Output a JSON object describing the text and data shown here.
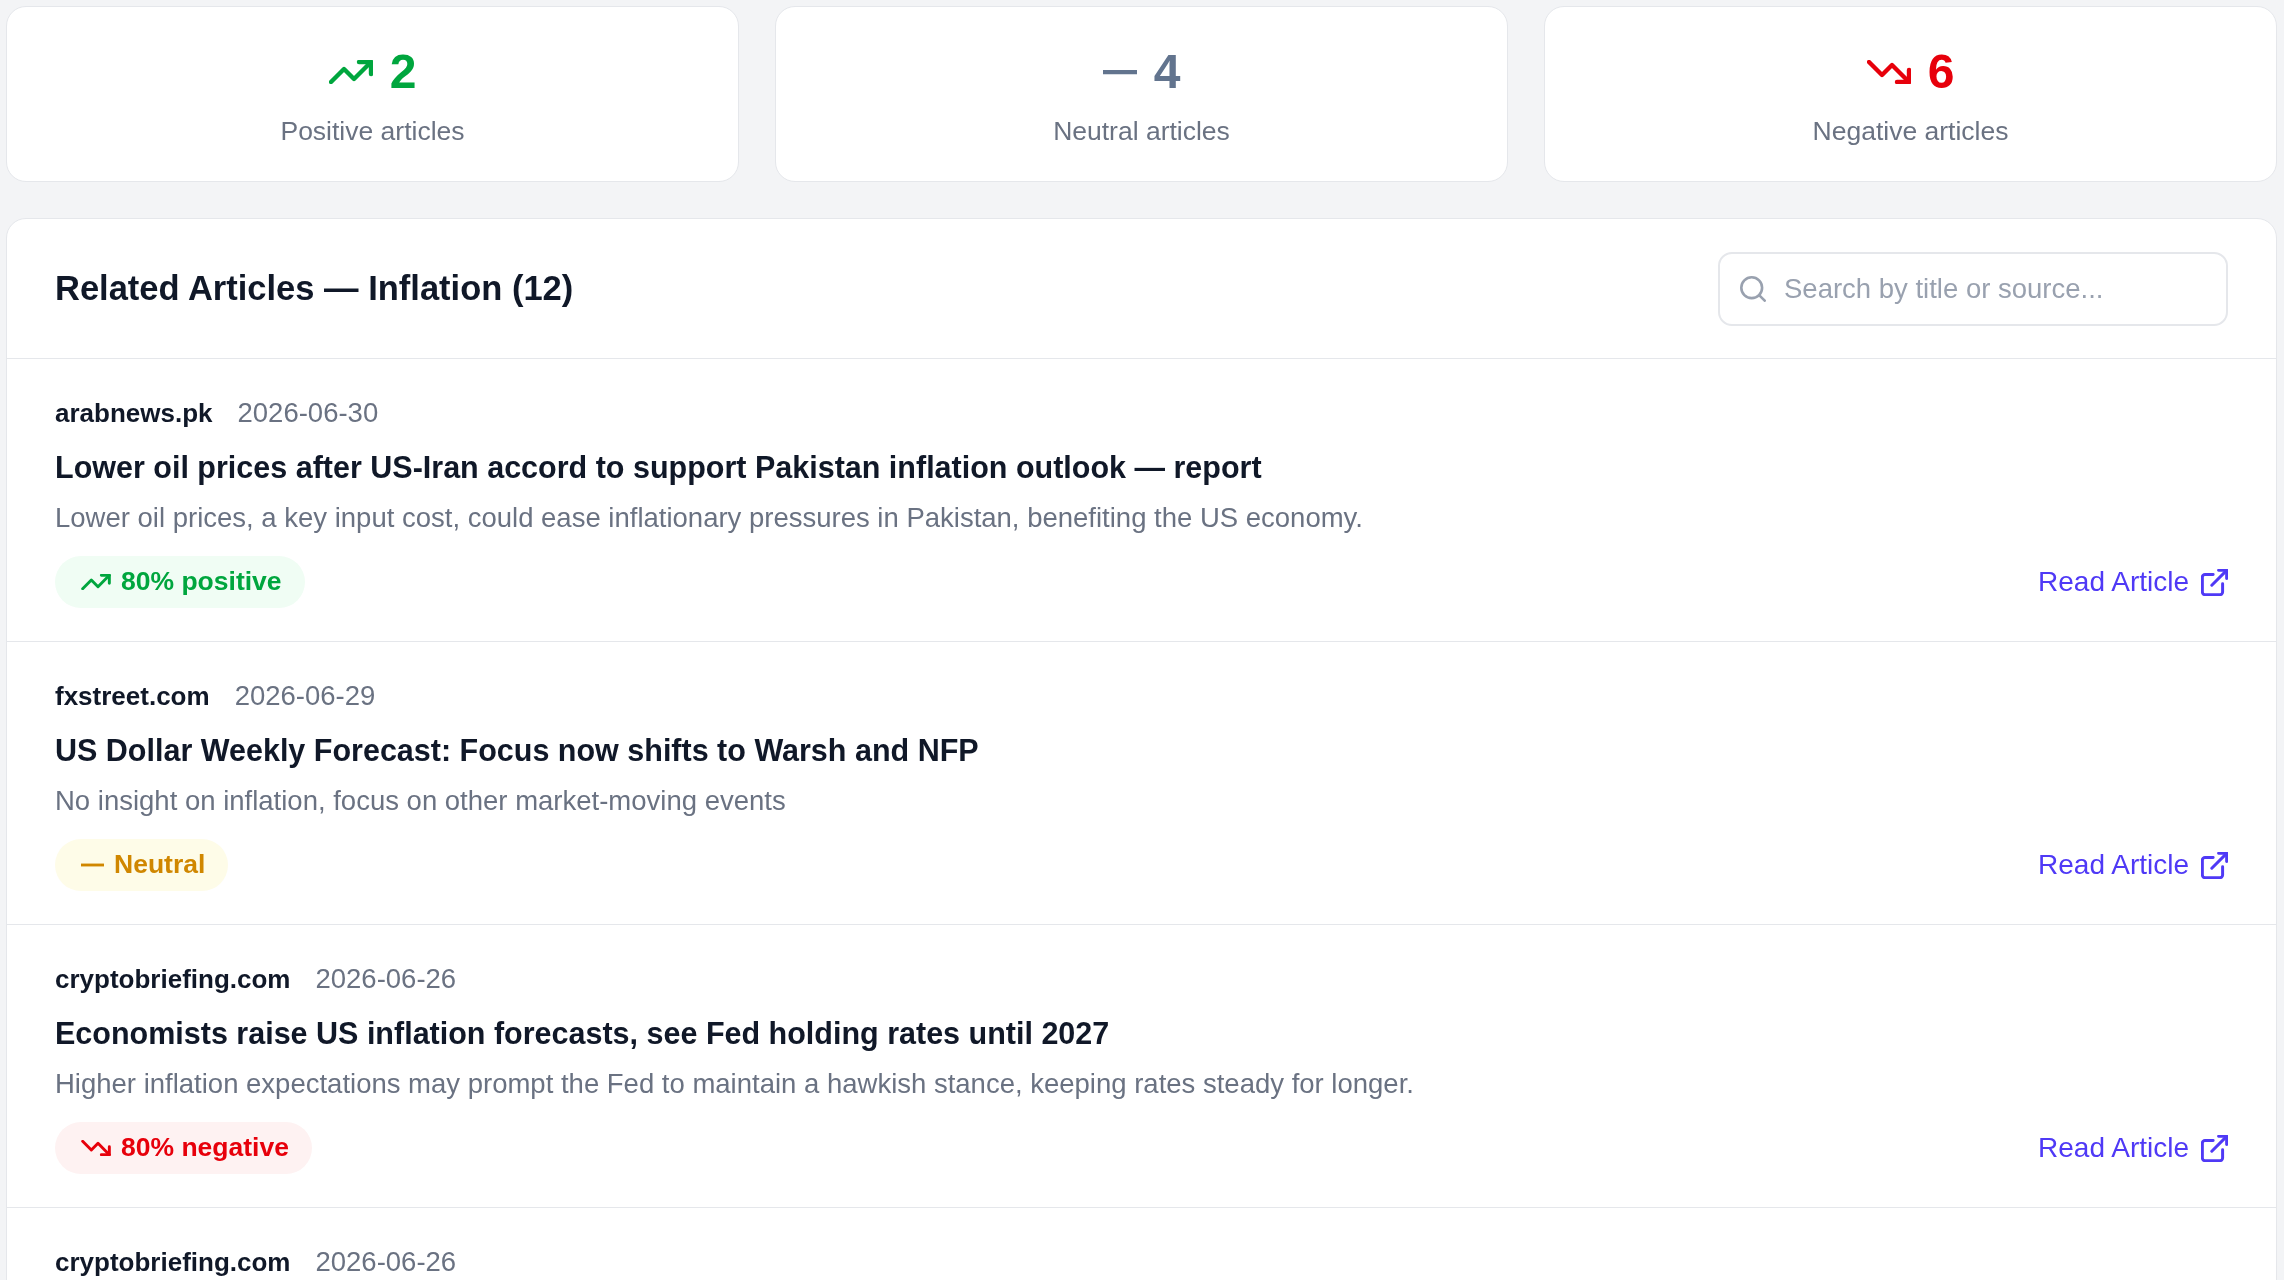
{
  "summary_cards": [
    {
      "kind": "positive",
      "count": "2",
      "label": "Positive articles"
    },
    {
      "kind": "neutral",
      "count": "4",
      "label": "Neutral articles"
    },
    {
      "kind": "negative",
      "count": "6",
      "label": "Negative articles"
    }
  ],
  "articles_panel": {
    "title": "Related Articles — Inflation (12)",
    "search": {
      "placeholder": "Search by title or source..."
    },
    "articles": [
      {
        "source": "arabnews.pk",
        "date": "2026-06-30",
        "title": "Lower oil prices after US-Iran accord to support Pakistan inflation outlook — report",
        "summary": "Lower oil prices, a key input cost, could ease inflationary pressures in Pakistan, benefiting the US economy.",
        "sentiment": {
          "kind": "positive",
          "label": "80% positive"
        },
        "link": "Read Article"
      },
      {
        "source": "fxstreet.com",
        "date": "2026-06-29",
        "title": "US Dollar Weekly Forecast: Focus now shifts to Warsh and NFP",
        "summary": "No insight on inflation, focus on other market-moving events",
        "sentiment": {
          "kind": "neutral",
          "label": "Neutral"
        },
        "link": "Read Article"
      },
      {
        "source": "cryptobriefing.com",
        "date": "2026-06-26",
        "title": "Economists raise US inflation forecasts, see Fed holding rates until 2027",
        "summary": "Higher inflation expectations may prompt the Fed to maintain a hawkish stance, keeping rates steady for longer.",
        "sentiment": {
          "kind": "negative",
          "label": "80% negative"
        },
        "link": "Read Article"
      },
      {
        "source": "cryptobriefing.com",
        "date": "2026-06-26"
      }
    ]
  }
}
